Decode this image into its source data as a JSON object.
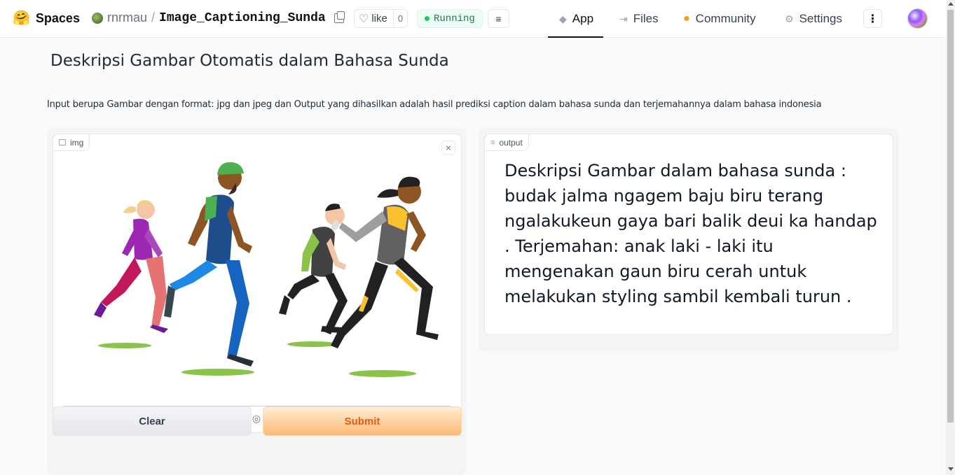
{
  "header": {
    "logo_text": "Spaces",
    "owner": "rnrmau",
    "separator": "/",
    "repo_name": "Image_Captioning_Sunda",
    "like_label": "like",
    "like_count": "0",
    "status": "Running",
    "nav": {
      "app": "App",
      "files": "Files",
      "community": "Community",
      "settings": "Settings"
    }
  },
  "page": {
    "title": "Deskripsi Gambar Otomatis dalam Bahasa Sunda",
    "description": "Input berupa Gambar dengan format: jpg dan jpeg dan Output yang dihasilkan adalah hasil prediksi caption dalam bahasa sunda dan terjemahannya dalam bahasa indonesia"
  },
  "input": {
    "label": "img",
    "close": "×"
  },
  "output": {
    "label": "output",
    "text": "Deskripsi Gambar dalam bahasa sunda : budak jalma ngagem baju biru terang ngalakukeun gaya bari balik deui ka handap . Terjemahan: anak laki - laki itu mengenakan gaun biru cerah untuk melakukan styling sambil kembali turun ."
  },
  "buttons": {
    "clear": "Clear",
    "submit": "Submit"
  },
  "colors": {
    "accent": "#f97316",
    "running": "#22c55e"
  }
}
